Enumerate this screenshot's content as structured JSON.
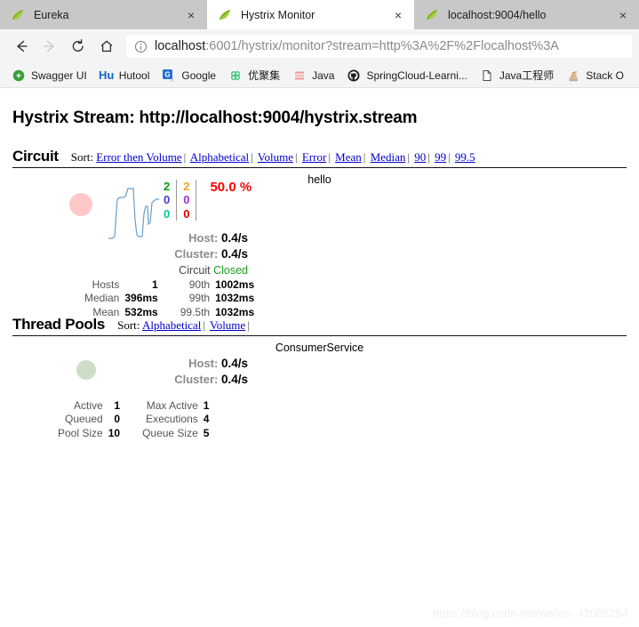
{
  "browser": {
    "tabs": [
      {
        "title": "Eureka",
        "icon": "spring-leaf-icon",
        "active": false,
        "close": "×"
      },
      {
        "title": "Hystrix Monitor",
        "icon": "spring-leaf-icon",
        "active": true,
        "close": "×"
      },
      {
        "title": "localhost:9004/hello",
        "icon": "spring-leaf-icon",
        "active": false,
        "close": "×"
      }
    ],
    "nav": {
      "back": "back-arrow-icon",
      "forward": "forward-arrow-icon",
      "reload": "reload-icon",
      "home": "home-icon"
    },
    "url": {
      "info_icon": "info-circle-icon",
      "host": "localhost",
      "rest": ":6001/hystrix/monitor?stream=http%3A%2F%2Flocalhost%3A"
    },
    "bookmarks": [
      {
        "label": "Swagger UI",
        "icon": "swagger-icon"
      },
      {
        "label": "Hutool",
        "icon": "hutool-icon"
      },
      {
        "label": "Google",
        "icon": "google-icon"
      },
      {
        "label": "优聚集",
        "icon": "clover-icon"
      },
      {
        "label": "Java",
        "icon": "java-stack-icon"
      },
      {
        "label": "SpringCloud-Learni...",
        "icon": "github-icon"
      },
      {
        "label": "Java工程师",
        "icon": "document-icon"
      },
      {
        "label": "Stack O",
        "icon": "stackoverflow-icon"
      }
    ]
  },
  "page": {
    "stream_title": "Hystrix Stream: http://localhost:9004/hystrix.stream",
    "watermark": "https://blog.csdn.net/weixin_42068254",
    "circuit": {
      "heading": "Circuit",
      "sort_label": "Sort:",
      "sort_links": [
        "Error then Volume",
        "Alphabetical",
        "Volume",
        "Error",
        "Mean",
        "Median",
        "90",
        "99",
        "99.5"
      ],
      "separator": "|",
      "monitor": {
        "name": "hello",
        "blob_color": "#ffc8c8",
        "counters_left": [
          {
            "value": "2",
            "color": "#00a000"
          },
          {
            "value": "0",
            "color": "#4040d0"
          },
          {
            "value": "0",
            "color": "#00cc99"
          }
        ],
        "counters_right": [
          {
            "value": "2",
            "color": "#f5a623"
          },
          {
            "value": "0",
            "color": "#a030d0"
          },
          {
            "value": "0",
            "color": "#e00000"
          }
        ],
        "error_percent": "50.0 %",
        "error_color": "#ff0000",
        "host_label": "Host:",
        "host_value": "0.4/s",
        "cluster_label": "Cluster:",
        "cluster_value": "0.4/s",
        "circuit_label": "Circuit",
        "circuit_status": "Closed",
        "circuit_status_color": "#1a9e1a",
        "stats": [
          {
            "l1": "Hosts",
            "v1": "1",
            "l2": "90th",
            "v2": "1002ms"
          },
          {
            "l1": "Median",
            "v1": "396ms",
            "l2": "99th",
            "v2": "1032ms"
          },
          {
            "l1": "Mean",
            "v1": "532ms",
            "l2": "99.5th",
            "v2": "1032ms"
          }
        ]
      }
    },
    "thread_pools": {
      "heading": "Thread Pools",
      "sort_label": "Sort:",
      "sort_links": [
        "Alphabetical",
        "Volume"
      ],
      "separator": "|",
      "pool": {
        "name": "ConsumerService",
        "blob_color": "#cdddc8",
        "host_label": "Host:",
        "host_value": "0.4/s",
        "cluster_label": "Cluster:",
        "cluster_value": "0.4/s",
        "stats": [
          {
            "l1": "Active",
            "v1": "1",
            "l2": "Max Active",
            "v2": "1"
          },
          {
            "l1": "Queued",
            "v1": "0",
            "l2": "Executions",
            "v2": "4"
          },
          {
            "l1": "Pool Size",
            "v1": "10",
            "l2": "Queue Size",
            "v2": "5"
          }
        ]
      }
    }
  }
}
